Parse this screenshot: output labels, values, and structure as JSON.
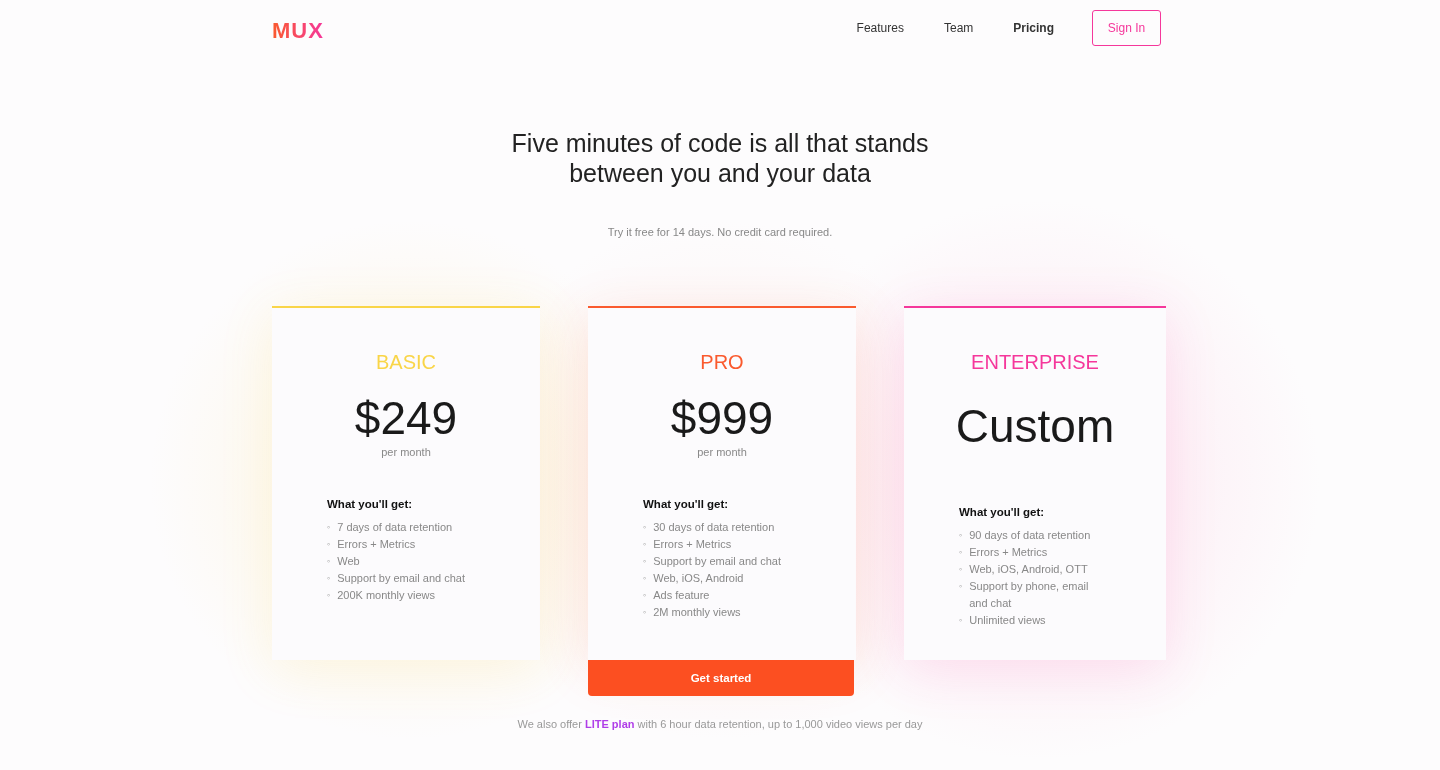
{
  "header": {
    "logo": "MUX",
    "nav": [
      {
        "label": "Features",
        "selected": false
      },
      {
        "label": "Team",
        "selected": false
      },
      {
        "label": "Pricing",
        "selected": true
      }
    ],
    "sign_in": "Sign In"
  },
  "hero": {
    "title_lines": [
      "Five minutes of code is all that stands",
      "between you and your data"
    ],
    "subtitle": "Try it free for 14 days. No credit card required."
  },
  "plans": [
    {
      "name": "BASIC",
      "color": "#f9d548",
      "bullet": "◦",
      "price": "$249",
      "period": "per month",
      "features_title": "What you'll get:",
      "features": [
        "7 days of data retention",
        "Errors + Metrics",
        "Web",
        "Support by email and chat",
        "200K monthly views"
      ]
    },
    {
      "name": "PRO",
      "color": "#fa5a2e",
      "bullet": "◦",
      "price": "$999",
      "period": "per month",
      "features_title": "What you'll get:",
      "features": [
        "30 days of data retention",
        "Errors + Metrics",
        "Support by email and chat",
        "Web, iOS, Android",
        "Ads feature",
        "2M monthly views"
      ],
      "action": "Get started"
    },
    {
      "name": "ENTERPRISE",
      "color": "#f5379b",
      "bullet": "◦",
      "price": "Custom",
      "features_title": "What you'll get:",
      "features": [
        "90 days of data retention",
        "Errors + Metrics",
        "Web, iOS, Android, OTT",
        "Support by phone, email and chat",
        "Unlimited views"
      ]
    }
  ],
  "footer_note": {
    "before": "We also offer",
    "link": "LITE plan",
    "after": "with 6 hour data retention, up to 1,000 video views per day"
  }
}
